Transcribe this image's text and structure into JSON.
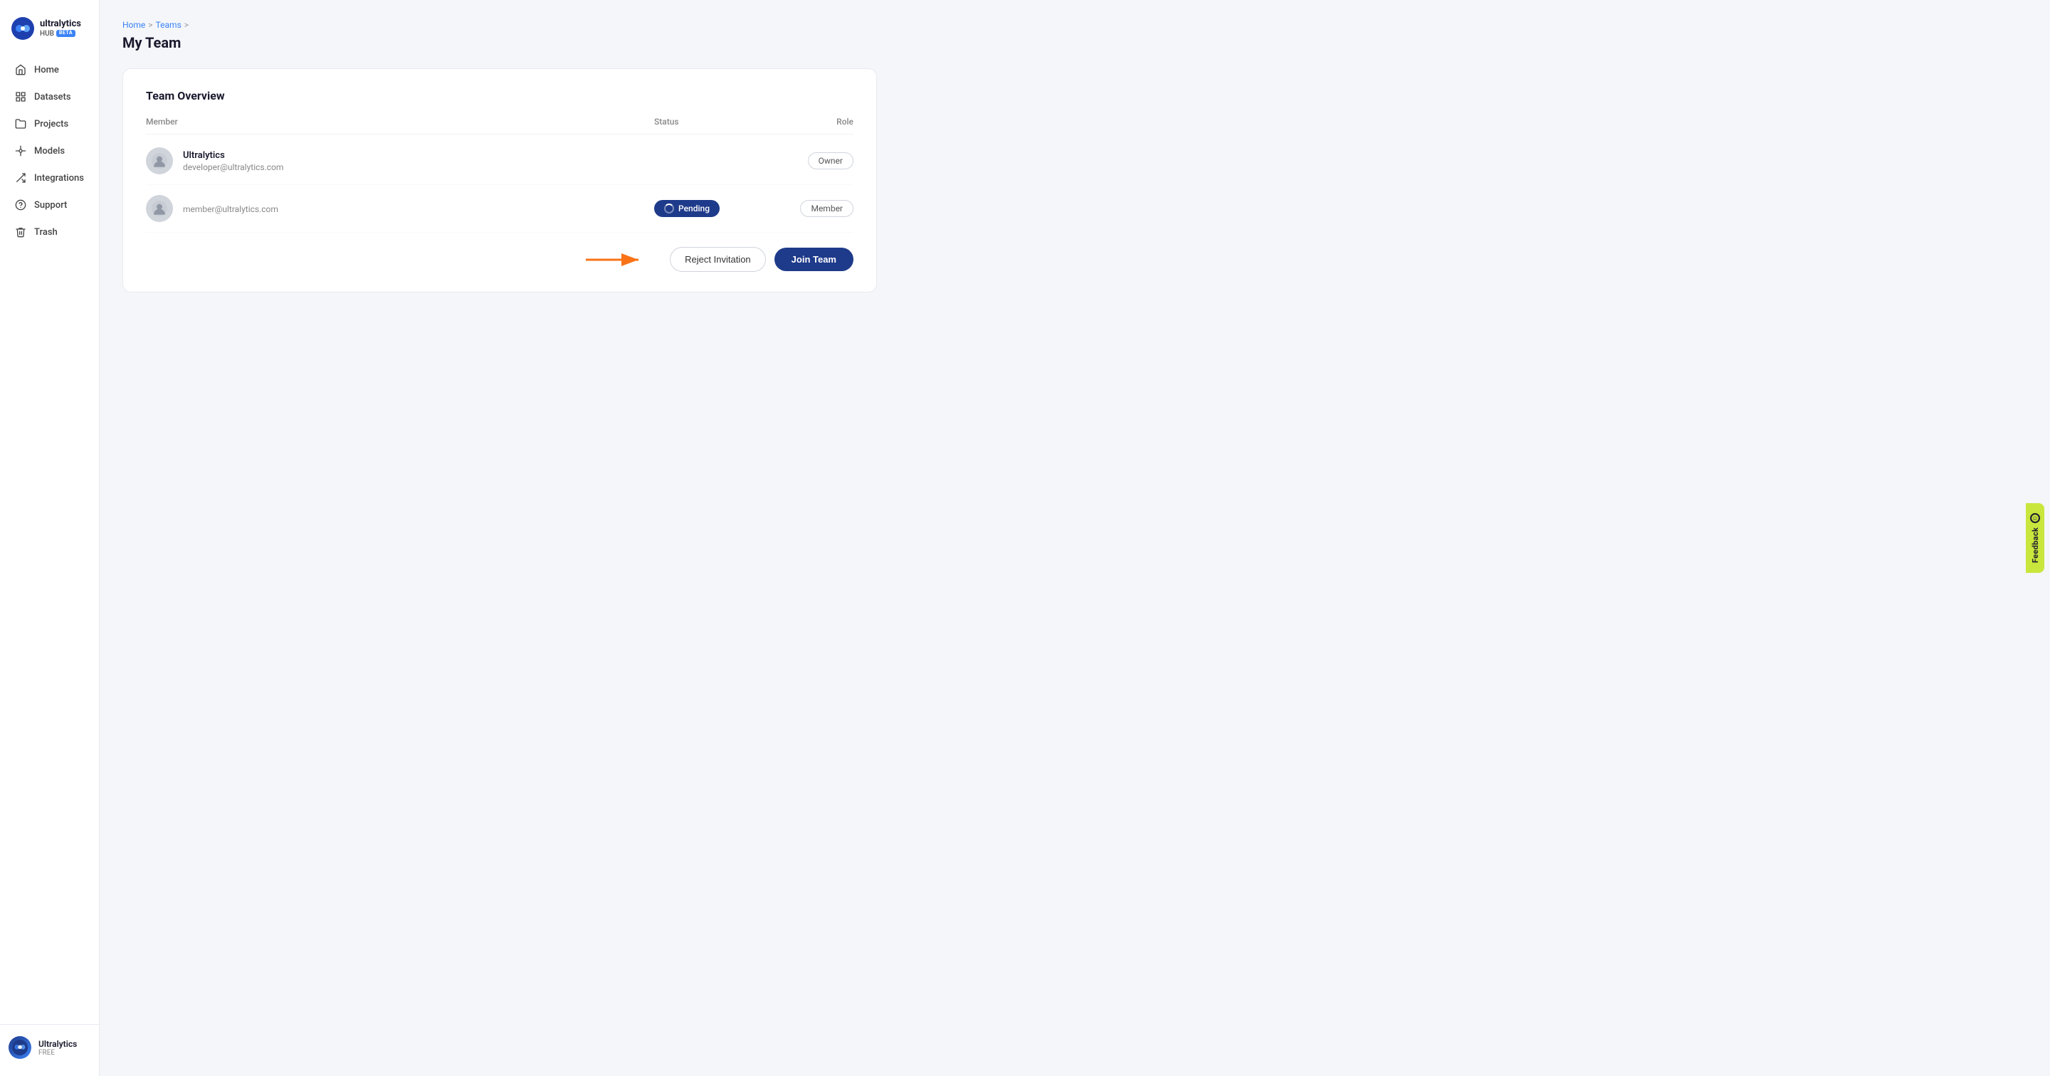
{
  "app": {
    "name": "ultralytics",
    "hub": "HUB",
    "beta": "BETA"
  },
  "sidebar": {
    "items": [
      {
        "id": "home",
        "label": "Home",
        "icon": "home"
      },
      {
        "id": "datasets",
        "label": "Datasets",
        "icon": "datasets"
      },
      {
        "id": "projects",
        "label": "Projects",
        "icon": "projects"
      },
      {
        "id": "models",
        "label": "Models",
        "icon": "models"
      },
      {
        "id": "integrations",
        "label": "Integrations",
        "icon": "integrations"
      },
      {
        "id": "support",
        "label": "Support",
        "icon": "support"
      },
      {
        "id": "trash",
        "label": "Trash",
        "icon": "trash"
      }
    ]
  },
  "user": {
    "name": "Ultralytics",
    "plan": "FREE"
  },
  "breadcrumb": {
    "home": "Home",
    "teams": "Teams",
    "current": "My Team"
  },
  "page": {
    "title": "My Team"
  },
  "teamCard": {
    "title": "Team Overview",
    "columns": {
      "member": "Member",
      "status": "Status",
      "role": "Role"
    },
    "members": [
      {
        "name": "Ultralytics",
        "email": "developer@ultralytics.com",
        "status": "",
        "role": "Owner"
      },
      {
        "name": "",
        "email": "member@ultralytics.com",
        "status": "Pending",
        "role": "Member"
      }
    ]
  },
  "actions": {
    "reject_label": "Reject Invitation",
    "join_label": "Join Team"
  },
  "feedback": {
    "label": "Feedback"
  }
}
